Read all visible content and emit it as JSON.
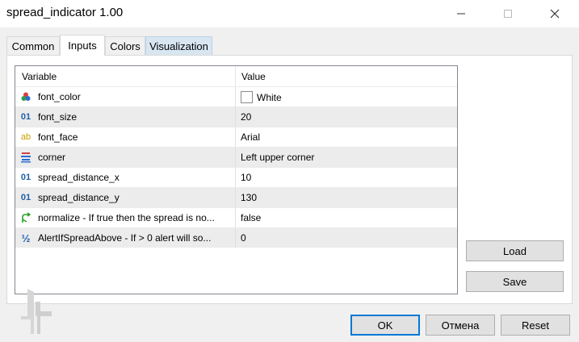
{
  "window": {
    "title": "spread_indicator 1.00",
    "controls": [
      "minimize-icon",
      "maximize-icon",
      "close-icon"
    ]
  },
  "tabs": [
    {
      "label": "Common",
      "active": false
    },
    {
      "label": "Inputs",
      "active": true
    },
    {
      "label": "Colors",
      "active": false
    },
    {
      "label": "Visualization",
      "active": false
    }
  ],
  "table": {
    "headers": {
      "variable": "Variable",
      "value": "Value"
    },
    "rows": [
      {
        "icon": "color-palette-icon",
        "name": "font_color",
        "value": "White",
        "swatch": "#ffffff"
      },
      {
        "icon": "integer-icon",
        "name": "font_size",
        "value": "20"
      },
      {
        "icon": "string-icon",
        "name": "font_face",
        "value": "Arial"
      },
      {
        "icon": "enum-icon",
        "name": "corner",
        "value": "Left upper corner"
      },
      {
        "icon": "integer-icon",
        "name": "spread_distance_x",
        "value": "10"
      },
      {
        "icon": "integer-icon",
        "name": "spread_distance_y",
        "value": "130"
      },
      {
        "icon": "boolean-icon",
        "name": "normalize - If true then the spread is no...",
        "value": "false"
      },
      {
        "icon": "fraction-icon",
        "name": "AlertIfSpreadAbove - If > 0 alert will so...",
        "value": "0"
      }
    ]
  },
  "buttons": {
    "load": "Load",
    "save": "Save",
    "ok": "OK",
    "cancel": "Отмена",
    "reset": "Reset"
  },
  "icon_glyphs": {
    "integer": "01",
    "string": "ab",
    "fraction": "½"
  },
  "colors": {
    "accent": "#0078d7",
    "integer_icon": "#1f5fa8",
    "string_icon": "#c8a000",
    "boolean_icon": "#2a9d2a"
  }
}
